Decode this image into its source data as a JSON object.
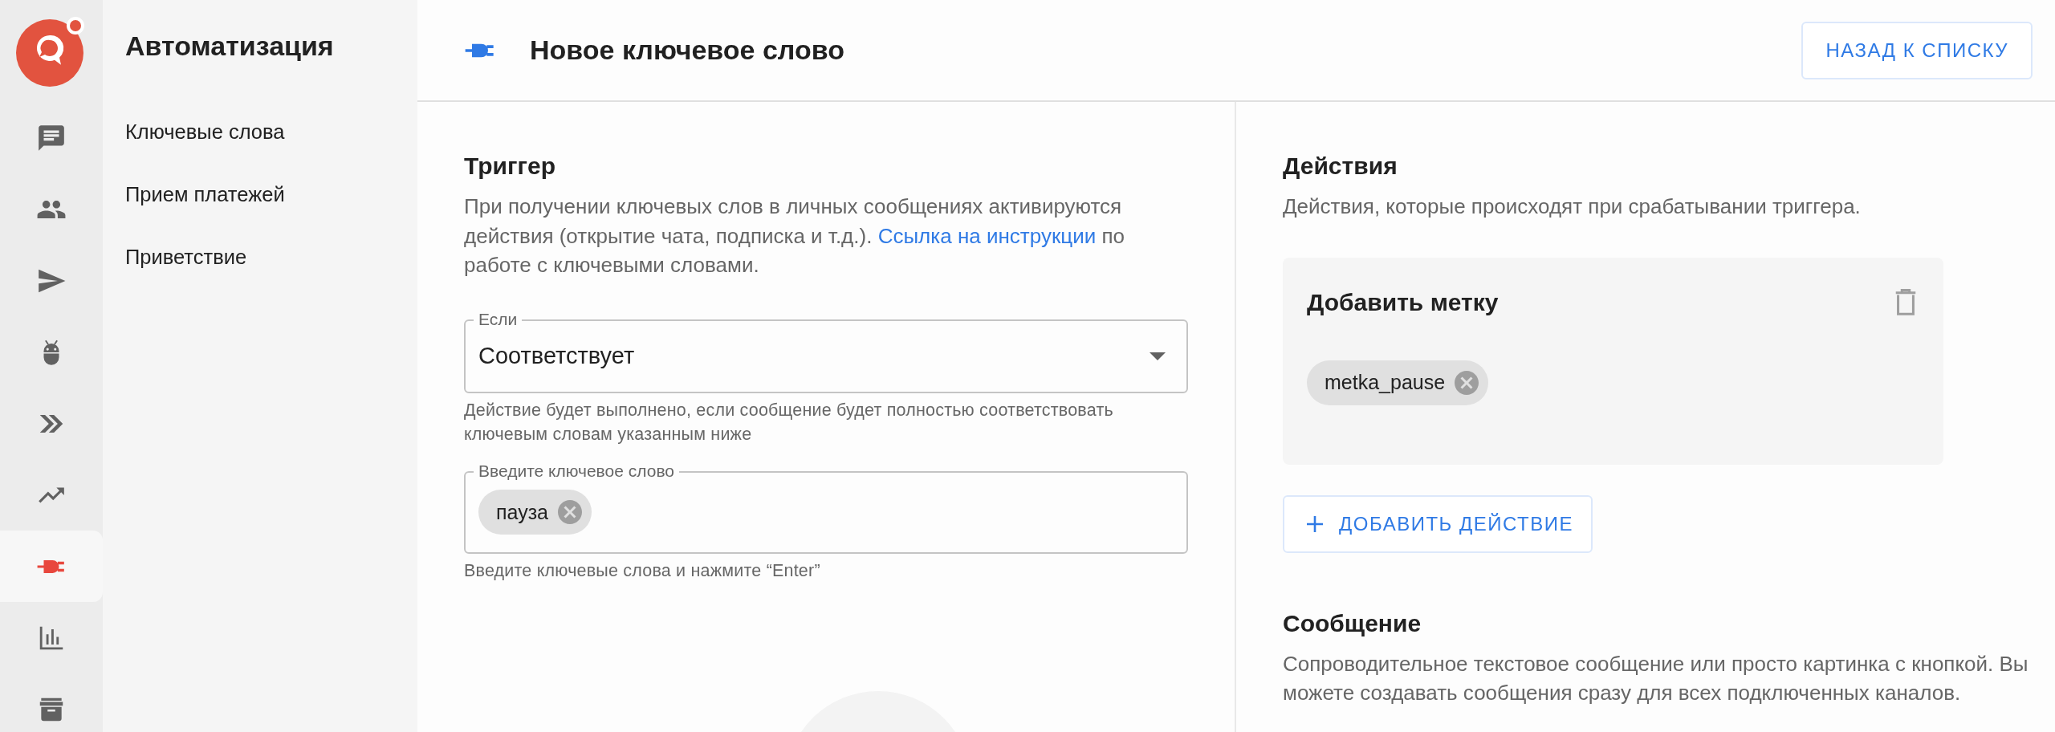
{
  "rail": {
    "items": [
      {
        "selected": false
      },
      {
        "selected": false
      },
      {
        "selected": false
      },
      {
        "selected": false
      },
      {
        "selected": false
      },
      {
        "selected": false
      },
      {
        "selected": true
      },
      {
        "selected": false
      },
      {
        "selected": false
      }
    ]
  },
  "sidebar": {
    "title": "Автоматизация",
    "items": [
      "Ключевые слова",
      "Прием платежей",
      "Приветствие"
    ]
  },
  "header": {
    "title": "Новое ключевое слово",
    "back_button": "НАЗАД К СПИСКУ"
  },
  "trigger": {
    "heading": "Триггер",
    "description": "При получении ключевых слов в личных сообщениях активируются действия (открытие чата, подписка и т.д.).",
    "link": "Ссылка на инструкции",
    "description_end": "по работе с ключевыми словами.",
    "condition": {
      "label": "Если",
      "value": "Соответствует",
      "helper": "Действие будет выполнено, если сообщение будет полностью соответствовать ключевым словам указанным ниже"
    },
    "keywords": {
      "label": "Введите ключевое слово",
      "chips": [
        "пауза"
      ],
      "helper": "Введите ключевые слова и нажмите “Enter”"
    }
  },
  "actions": {
    "heading": "Действия",
    "description": "Действия, которые происходят при срабатывании триггера.",
    "cards": [
      {
        "title": "Добавить метку",
        "chips": [
          "metka_pause"
        ]
      }
    ],
    "add_button": "ДОБАВИТЬ ДЕЙСТВИЕ"
  },
  "message": {
    "heading": "Сообщение",
    "description": "Сопроводительное текстовое сообщение или просто картинка с кнопкой. Вы можете создавать сообщения сразу для всех подключенных каналов."
  }
}
